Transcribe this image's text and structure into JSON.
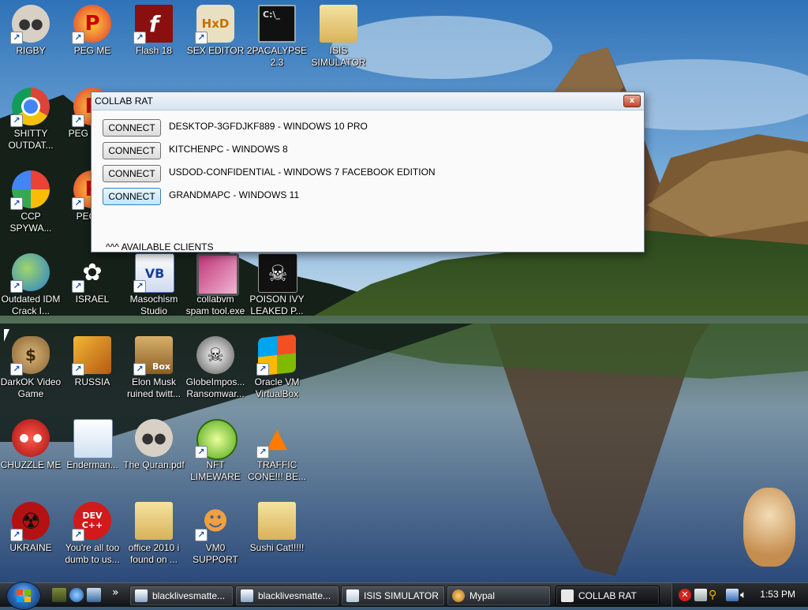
{
  "desktop": {
    "icons": [
      {
        "label": "RIGBY",
        "icon": "raccoon-icon"
      },
      {
        "label": "PEG ME",
        "icon": "peg-icon"
      },
      {
        "label": "Flash 18",
        "icon": "flash-icon"
      },
      {
        "label": "SEX EDITOR",
        "icon": "hxd-icon"
      },
      {
        "label": "2PACALYPSE 2.3",
        "icon": "terminal-icon"
      },
      {
        "label": "ISIS SIMULATOR",
        "icon": "folder-icon"
      },
      {
        "label": "SHITTY OUTDAT...",
        "icon": "chrome-icon"
      },
      {
        "label": "PEG WOW",
        "icon": "peg-icon"
      },
      {
        "label": "CCP SPYWA...",
        "icon": "pinwheel-icon"
      },
      {
        "label": "PEG NI",
        "icon": "peg-icon"
      },
      {
        "label": "Outdated IDM Crack I...",
        "icon": "idm-icon"
      },
      {
        "label": "ISRAEL",
        "icon": "flower-icon"
      },
      {
        "label": "Masochism Studio",
        "icon": "vb-icon"
      },
      {
        "label": "collabvm spam tool.exe",
        "icon": "monitor-icon"
      },
      {
        "label": "POISON IVY LEAKED P...",
        "icon": "skull-icon"
      },
      {
        "label": "DarkOK Video Game",
        "icon": "moneybag-icon"
      },
      {
        "label": "RUSSIA",
        "icon": "gold-icon"
      },
      {
        "label": "Elon Musk ruined twitt...",
        "icon": "hamster-box-icon"
      },
      {
        "label": "GlobeImpos... Ransomwar...",
        "icon": "globe-skull-icon"
      },
      {
        "label": "Oracle VM VirtualBox",
        "icon": "windows-flag-icon"
      },
      {
        "label": "CHUZZLE ME",
        "icon": "chuzzle-icon"
      },
      {
        "label": "Enderman...",
        "icon": "window-app-icon"
      },
      {
        "label": "The Quran.pdf",
        "icon": "raccoon-icon"
      },
      {
        "label": "NFT LIMEWARE",
        "icon": "lime-icon"
      },
      {
        "label": "TRAFFIC CONE!!! BE...",
        "icon": "cone-icon"
      },
      {
        "label": "UKRAINE",
        "icon": "radiation-icon"
      },
      {
        "label": "You're all too dumb to us...",
        "icon": "devcpp-icon"
      },
      {
        "label": "office 2010 i found on ...",
        "icon": "folder-icon"
      },
      {
        "label": "VM0 SUPPORT",
        "icon": "support-person-icon"
      },
      {
        "label": "Sushi Cat!!!!!",
        "icon": "folder-icon"
      }
    ],
    "devcpp_text": "DEV\nC++",
    "flash_letter": "f",
    "hxd_text": "HxD",
    "terminal_text": "C:\\_",
    "vb_text": "VB",
    "box_text": "Box"
  },
  "window": {
    "title": "COLLAB RAT",
    "close_glyph": "x",
    "button_label": "CONNECT",
    "clients": [
      "DESKTOP-3GFDJKF889 - WINDOWS 10 PRO",
      "KITCHENPC - WINDOWS 8",
      "USDOD-CONFIDENTIAL - WINDOWS 7 FACEBOOK EDITION",
      "GRANDMAPC - WINDOWS 11"
    ],
    "available_label": "^^^ AVAILABLE CLIENTS"
  },
  "taskbar": {
    "overflow_glyph": "»",
    "tasks": [
      {
        "label": "blacklivesmatte...",
        "icon": "browser-window-icon",
        "active": false
      },
      {
        "label": "blacklivesmatte...",
        "icon": "browser-window-icon",
        "active": false
      },
      {
        "label": "ISIS SIMULATOR",
        "icon": "window-app-icon",
        "active": false
      },
      {
        "label": "Mypal",
        "icon": "mypal-icon",
        "active": false
      },
      {
        "label": "COLLAB RAT",
        "icon": "rat-app-icon",
        "active": true
      }
    ],
    "clock": "1:53 PM"
  },
  "colors": {
    "accent": "#2a6ab8",
    "close_red": "#c7462a",
    "taskbar_dark": "#101214"
  }
}
